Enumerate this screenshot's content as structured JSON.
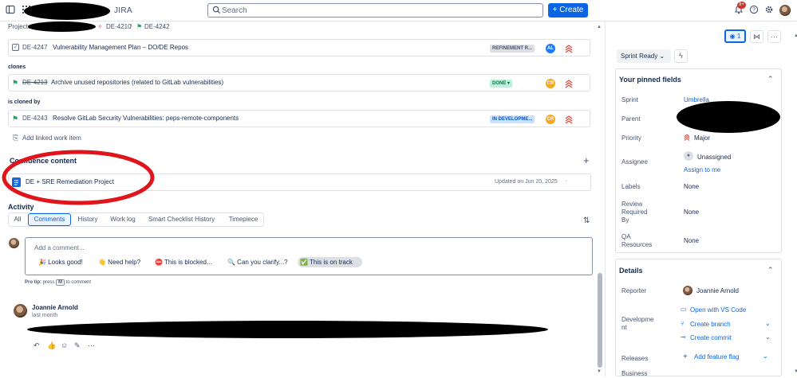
{
  "header": {
    "brand": "JIRA",
    "search_placeholder": "Search",
    "create_label": "+ Create",
    "notification_count": "9+"
  },
  "breadcrumb": {
    "root": "Projects",
    "parent": "DE-4210",
    "sep": "/",
    "current": "DE-4242"
  },
  "linked": {
    "item1": {
      "key": "DE-4247",
      "title": "Vulnerability Management Plan – DO/DE Repos",
      "status": "REFINEMENT R...",
      "assignee": "AL"
    },
    "clones_label": "clones",
    "item2": {
      "key": "DE-4213",
      "title": "Archive unused repositories (related to GitLab vulnerabilities)",
      "status": "DONE",
      "assignee": "CR"
    },
    "cloned_by_label": "is cloned by",
    "item3": {
      "key": "DE-4243",
      "title": "Resolve GitLab Security Vulnerabilities: peps-remote-components",
      "status": "IN DEVELOPME...",
      "assignee": "CR"
    },
    "add_link": "Add linked work item"
  },
  "confluence": {
    "heading": "Confluence content",
    "page_title": "DE + SRE Remediation Project",
    "updated": "Updated on Jun 20, 2025"
  },
  "activity": {
    "heading": "Activity",
    "tabs": [
      "All",
      "Comments",
      "History",
      "Work log",
      "Smart Checklist History",
      "Timepiece"
    ],
    "comment_placeholder": "Add a comment...",
    "chips": [
      "🎉 Looks good!",
      "👋 Need help?",
      "⛔ This is blocked...",
      "🔍 Can you clarify...?",
      "✅ This is on track"
    ],
    "pro_tip_a": "Pro tip:",
    "pro_tip_b": "press",
    "pro_tip_key": "M",
    "pro_tip_c": "to comment",
    "comment_author": "Joannie Arnold",
    "comment_time": "last month"
  },
  "side": {
    "watchers": "1",
    "status": "Sprint Ready",
    "pinned_heading": "Your pinned fields",
    "sprint_label": "Sprint",
    "sprint_value": "Umbrella",
    "parent_label": "Parent",
    "priority_label": "Priority",
    "priority_value": "Major",
    "assignee_label": "Assignee",
    "assignee_value": "Unassigned",
    "assign_to_me": "Assign to me",
    "labels_label": "Labels",
    "labels_value": "None",
    "review_label_1": "Review",
    "review_label_2": "Required",
    "review_label_3": "By",
    "review_value": "None",
    "qa_label_1": "QA",
    "qa_label_2": "Resources",
    "qa_value": "None",
    "details_heading": "Details",
    "reporter_label": "Reporter",
    "reporter_value": "Joannie Arnold",
    "dev_label_1": "Developme",
    "dev_label_2": "nt",
    "dev_open_vs": "Open with VS Code",
    "dev_create_branch": "Create branch",
    "dev_create_commit": "Create commit",
    "releases_label": "Releases",
    "add_feature_flag": "Add feature flag",
    "business_label": "Business"
  },
  "colors": {
    "accent": "#0c66e4",
    "highlight_circle": "#e0141b",
    "priority_major": "#e2483d"
  }
}
